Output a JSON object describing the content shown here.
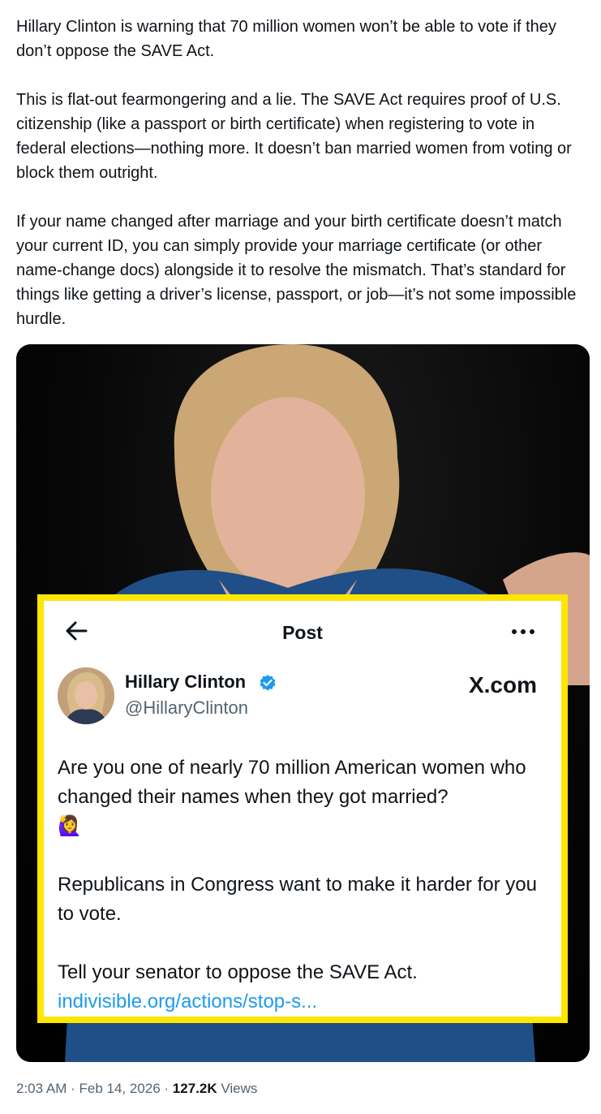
{
  "tweet": {
    "paragraphs": [
      "Hillary Clinton is warning that 70 million women won’t be able to vote if they don’t oppose the SAVE Act.",
      "This is flat-out fearmongering and a lie. The SAVE Act requires proof of U.S. citizenship (like a passport or birth certificate) when registering to vote in federal elections—nothing more. It doesn’t ban married women from voting or block them outright.",
      "If your name changed after marriage and your birth certificate doesn’t match your current ID, you can simply provide your marriage certificate (or other name-change docs) alongside it to resolve the mismatch. That’s standard for things like getting a driver’s license, passport, or job—it’s not some impossible hurdle."
    ]
  },
  "embedded_post": {
    "header_title": "Post",
    "back_icon": "arrow-left-icon",
    "more_icon": "more-dots-icon",
    "author_name": "Hillary Clinton",
    "author_handle": "@HillaryClinton",
    "verified_icon": "verified-badge-icon",
    "site_label": "X.com",
    "body_line1": "Are you one of nearly 70 million American women who changed their names when they got married?",
    "emoji": "🙋‍♀️",
    "body_line2": "Republicans in Congress want to make it harder for you to vote.",
    "body_line3": "Tell your senator to oppose the SAVE Act.",
    "link_text": "indivisible.org/actions/stop-s...",
    "border_color": "#ffe600",
    "link_color": "#1d9bf0"
  },
  "meta": {
    "time": "2:03 AM",
    "separator": " · ",
    "date": "Feb 14, 2026",
    "views_count": "127.2K",
    "views_label": " Views"
  }
}
